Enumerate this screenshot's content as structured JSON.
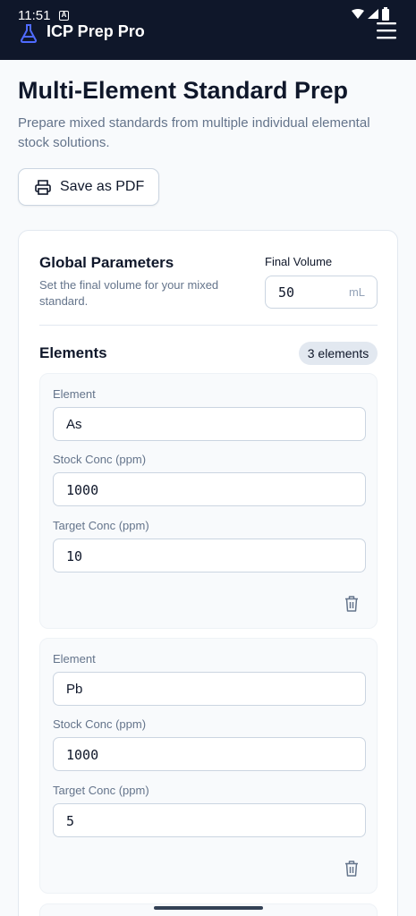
{
  "status_bar": {
    "time": "11:51",
    "notif_badge": "A"
  },
  "app_bar": {
    "title": "ICP Prep Pro",
    "app_icon": "flask-icon",
    "menu_icon": "hamburger-menu-icon"
  },
  "page": {
    "title": "Multi-Element Standard Prep",
    "subtitle": "Prepare mixed standards from multiple individual elemental stock solutions."
  },
  "actions": {
    "save_pdf_label": "Save as PDF",
    "save_pdf_icon": "printer-icon"
  },
  "global_params": {
    "title": "Global Parameters",
    "description": "Set the final volume for your mixed standard.",
    "final_volume_label": "Final Volume",
    "final_volume_value": "50",
    "final_volume_unit": "mL"
  },
  "elements_section": {
    "title": "Elements",
    "count_label": "3 elements",
    "items": [
      {
        "element_label": "Element",
        "element_value": "As",
        "stock_label": "Stock Conc (ppm)",
        "stock_value": "1000",
        "target_label": "Target Conc (ppm)",
        "target_value": "10",
        "delete_icon": "trash-icon"
      },
      {
        "element_label": "Element",
        "element_value": "Pb",
        "stock_label": "Stock Conc (ppm)",
        "stock_value": "1000",
        "target_label": "Target Conc (ppm)",
        "target_value": "5",
        "delete_icon": "trash-icon"
      }
    ]
  },
  "colors": {
    "header_bg": "#0f172a",
    "accent": "#4f6bff",
    "text_primary": "#0f172a",
    "text_muted": "#64748b"
  }
}
